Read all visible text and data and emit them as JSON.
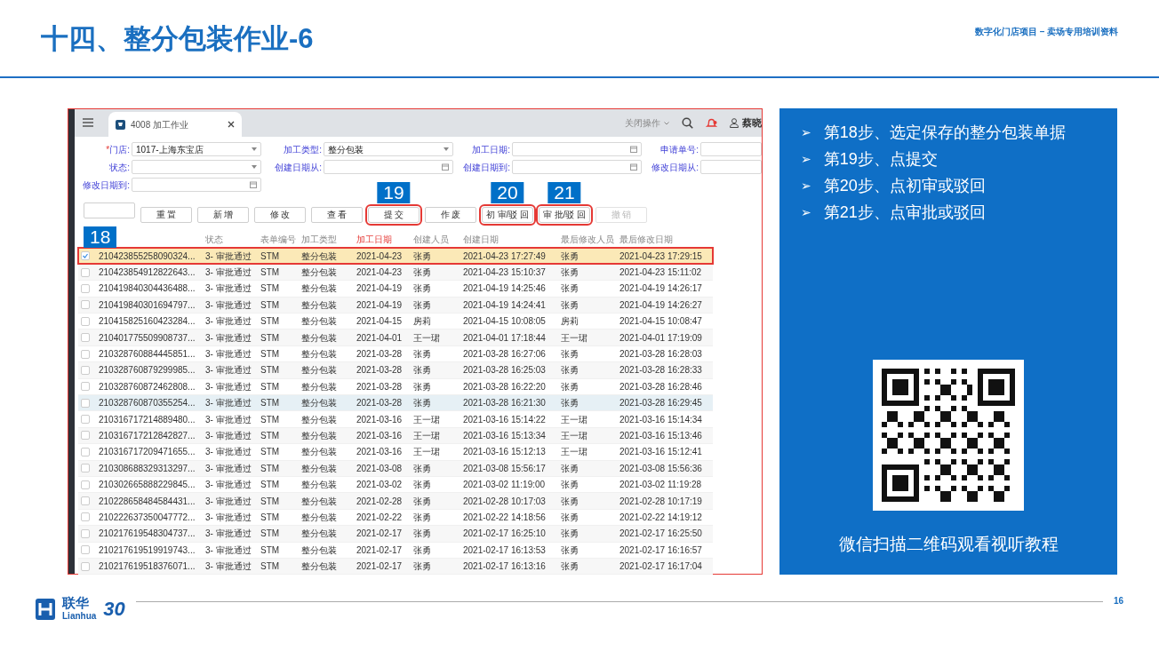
{
  "slide": {
    "title": "十四、整分包装作业-6",
    "header_note": "数字化门店项目 – 卖场专用培训资料",
    "page_number": "16"
  },
  "app": {
    "tab": {
      "label": "4008 加工作业",
      "selected": true
    },
    "top_actions": {
      "menu_label": "关闭操作",
      "user": "蔡晓"
    },
    "filters": [
      {
        "label": "门店:",
        "required_mark": "*",
        "kind": "select",
        "value": "1017-上海东宝店"
      },
      {
        "label": "加工类型:",
        "kind": "select",
        "value": "整分包装"
      },
      {
        "label": "加工日期:",
        "kind": "date"
      },
      {
        "label": "申请单号:",
        "kind": "text"
      },
      {
        "label": "状态:",
        "kind": "select"
      },
      {
        "label": "创建日期从:",
        "kind": "date"
      },
      {
        "label": "创建日期到:",
        "kind": "date"
      },
      {
        "label": "修改日期从:",
        "kind": "text"
      },
      {
        "label": "修改日期到:",
        "kind": "date"
      }
    ],
    "buttons": [
      {
        "disabled": false,
        "annotated": false
      },
      {
        "label": "重 置",
        "disabled": false,
        "annotated": false
      },
      {
        "label": "新 增",
        "disabled": false,
        "annotated": false
      },
      {
        "label": "修 改",
        "disabled": false,
        "annotated": false
      },
      {
        "label": "查 看",
        "disabled": false,
        "annotated": false
      },
      {
        "label": "提 交",
        "disabled": false,
        "annotated": true,
        "step": "19"
      },
      {
        "label": "作 废",
        "disabled": false,
        "annotated": false
      },
      {
        "label": "初 审/驳 回",
        "disabled": false,
        "annotated": true,
        "step": "20"
      },
      {
        "label": "审 批/驳 回",
        "disabled": false,
        "annotated": true,
        "step": "21"
      },
      {
        "label": "撤 销",
        "disabled": true,
        "annotated": false
      }
    ],
    "table": {
      "step": "18",
      "columns": [
        {
          "sorted": false
        },
        {
          "label": "状态",
          "sorted": false
        },
        {
          "label": "表单编号",
          "sorted": false
        },
        {
          "label": "加工类型",
          "sorted": false
        },
        {
          "label": "加工日期",
          "sorted": true
        },
        {
          "label": "创建人员",
          "sorted": false
        },
        {
          "label": "创建日期",
          "sorted": false
        },
        {
          "label": "最后修改人员",
          "sorted": false
        },
        {
          "label": "最后修改日期",
          "sorted": false
        }
      ],
      "rows": [
        {
          "selected": true,
          "hovered": false,
          "cells": [
            "210423855258090324...",
            "3- 审批通过",
            "STM",
            "整分包装",
            "2021-04-23",
            "张勇",
            "2021-04-23 17:27:49",
            "张勇",
            "2021-04-23 17:29:15"
          ]
        },
        {
          "selected": false,
          "hovered": false,
          "cells": [
            "210423854912822643...",
            "3- 审批通过",
            "STM",
            "整分包装",
            "2021-04-23",
            "张勇",
            "2021-04-23 15:10:37",
            "张勇",
            "2021-04-23 15:11:02"
          ]
        },
        {
          "selected": false,
          "hovered": false,
          "cells": [
            "210419840304436488...",
            "3- 审批通过",
            "STM",
            "整分包装",
            "2021-04-19",
            "张勇",
            "2021-04-19 14:25:46",
            "张勇",
            "2021-04-19 14:26:17"
          ]
        },
        {
          "selected": false,
          "hovered": false,
          "cells": [
            "210419840301694797...",
            "3- 审批通过",
            "STM",
            "整分包装",
            "2021-04-19",
            "张勇",
            "2021-04-19 14:24:41",
            "张勇",
            "2021-04-19 14:26:27"
          ]
        },
        {
          "selected": false,
          "hovered": false,
          "cells": [
            "210415825160423284...",
            "3- 审批通过",
            "STM",
            "整分包装",
            "2021-04-15",
            "房莉",
            "2021-04-15 10:08:05",
            "房莉",
            "2021-04-15 10:08:47"
          ]
        },
        {
          "selected": false,
          "hovered": false,
          "cells": [
            "210401775509908737...",
            "3- 审批通过",
            "STM",
            "整分包装",
            "2021-04-01",
            "王一珺",
            "2021-04-01 17:18:44",
            "王一珺",
            "2021-04-01 17:19:09"
          ]
        },
        {
          "selected": false,
          "hovered": false,
          "cells": [
            "210328760884445851...",
            "3- 审批通过",
            "STM",
            "整分包装",
            "2021-03-28",
            "张勇",
            "2021-03-28 16:27:06",
            "张勇",
            "2021-03-28 16:28:03"
          ]
        },
        {
          "selected": false,
          "hovered": false,
          "cells": [
            "210328760879299985...",
            "3- 审批通过",
            "STM",
            "整分包装",
            "2021-03-28",
            "张勇",
            "2021-03-28 16:25:03",
            "张勇",
            "2021-03-28 16:28:33"
          ]
        },
        {
          "selected": false,
          "hovered": false,
          "cells": [
            "210328760872462808...",
            "3- 审批通过",
            "STM",
            "整分包装",
            "2021-03-28",
            "张勇",
            "2021-03-28 16:22:20",
            "张勇",
            "2021-03-28 16:28:46"
          ]
        },
        {
          "selected": false,
          "hovered": true,
          "cells": [
            "210328760870355254...",
            "3- 审批通过",
            "STM",
            "整分包装",
            "2021-03-28",
            "张勇",
            "2021-03-28 16:21:30",
            "张勇",
            "2021-03-28 16:29:45"
          ]
        },
        {
          "selected": false,
          "hovered": false,
          "cells": [
            "210316717214889480...",
            "3- 审批通过",
            "STM",
            "整分包装",
            "2021-03-16",
            "王一珺",
            "2021-03-16 15:14:22",
            "王一珺",
            "2021-03-16 15:14:34"
          ]
        },
        {
          "selected": false,
          "hovered": false,
          "cells": [
            "210316717212842827...",
            "3- 审批通过",
            "STM",
            "整分包装",
            "2021-03-16",
            "王一珺",
            "2021-03-16 15:13:34",
            "王一珺",
            "2021-03-16 15:13:46"
          ]
        },
        {
          "selected": false,
          "hovered": false,
          "cells": [
            "210316717209471655...",
            "3- 审批通过",
            "STM",
            "整分包装",
            "2021-03-16",
            "王一珺",
            "2021-03-16 15:12:13",
            "王一珺",
            "2021-03-16 15:12:41"
          ]
        },
        {
          "selected": false,
          "hovered": false,
          "cells": [
            "210308688329313297...",
            "3- 审批通过",
            "STM",
            "整分包装",
            "2021-03-08",
            "张勇",
            "2021-03-08 15:56:17",
            "张勇",
            "2021-03-08 15:56:36"
          ]
        },
        {
          "selected": false,
          "hovered": false,
          "cells": [
            "210302665888229845...",
            "3- 审批通过",
            "STM",
            "整分包装",
            "2021-03-02",
            "张勇",
            "2021-03-02 11:19:00",
            "张勇",
            "2021-03-02 11:19:28"
          ]
        },
        {
          "selected": false,
          "hovered": false,
          "cells": [
            "210228658484584431...",
            "3- 审批通过",
            "STM",
            "整分包装",
            "2021-02-28",
            "张勇",
            "2021-02-28 10:17:03",
            "张勇",
            "2021-02-28 10:17:19"
          ]
        },
        {
          "selected": false,
          "hovered": false,
          "cells": [
            "210222637350047772...",
            "3- 审批通过",
            "STM",
            "整分包装",
            "2021-02-22",
            "张勇",
            "2021-02-22 14:18:56",
            "张勇",
            "2021-02-22 14:19:12"
          ]
        },
        {
          "selected": false,
          "hovered": false,
          "cells": [
            "210217619548304737...",
            "3- 审批通过",
            "STM",
            "整分包装",
            "2021-02-17",
            "张勇",
            "2021-02-17 16:25:10",
            "张勇",
            "2021-02-17 16:25:50"
          ]
        },
        {
          "selected": false,
          "hovered": false,
          "cells": [
            "210217619519919743...",
            "3- 审批通过",
            "STM",
            "整分包装",
            "2021-02-17",
            "张勇",
            "2021-02-17 16:13:53",
            "张勇",
            "2021-02-17 16:16:57"
          ]
        },
        {
          "selected": false,
          "hovered": false,
          "cells": [
            "210217619518376071...",
            "3- 审批通过",
            "STM",
            "整分包装",
            "2021-02-17",
            "张勇",
            "2021-02-17 16:13:16",
            "张勇",
            "2021-02-17 16:17:04"
          ]
        }
      ]
    }
  },
  "panel": {
    "steps": [
      {
        "marker": "➢",
        "text": "第18步、选定保存的整分包装单据"
      },
      {
        "marker": "➢",
        "text": "第19步、点提交"
      },
      {
        "marker": "➢",
        "text": "第20步、点初审或驳回"
      },
      {
        "marker": "➢",
        "text": "第21步、点审批或驳回"
      }
    ],
    "caption": "微信扫描二维码观看视听教程"
  },
  "logo": {
    "name": "联华",
    "latin": "Lianhua",
    "mark": "30"
  }
}
